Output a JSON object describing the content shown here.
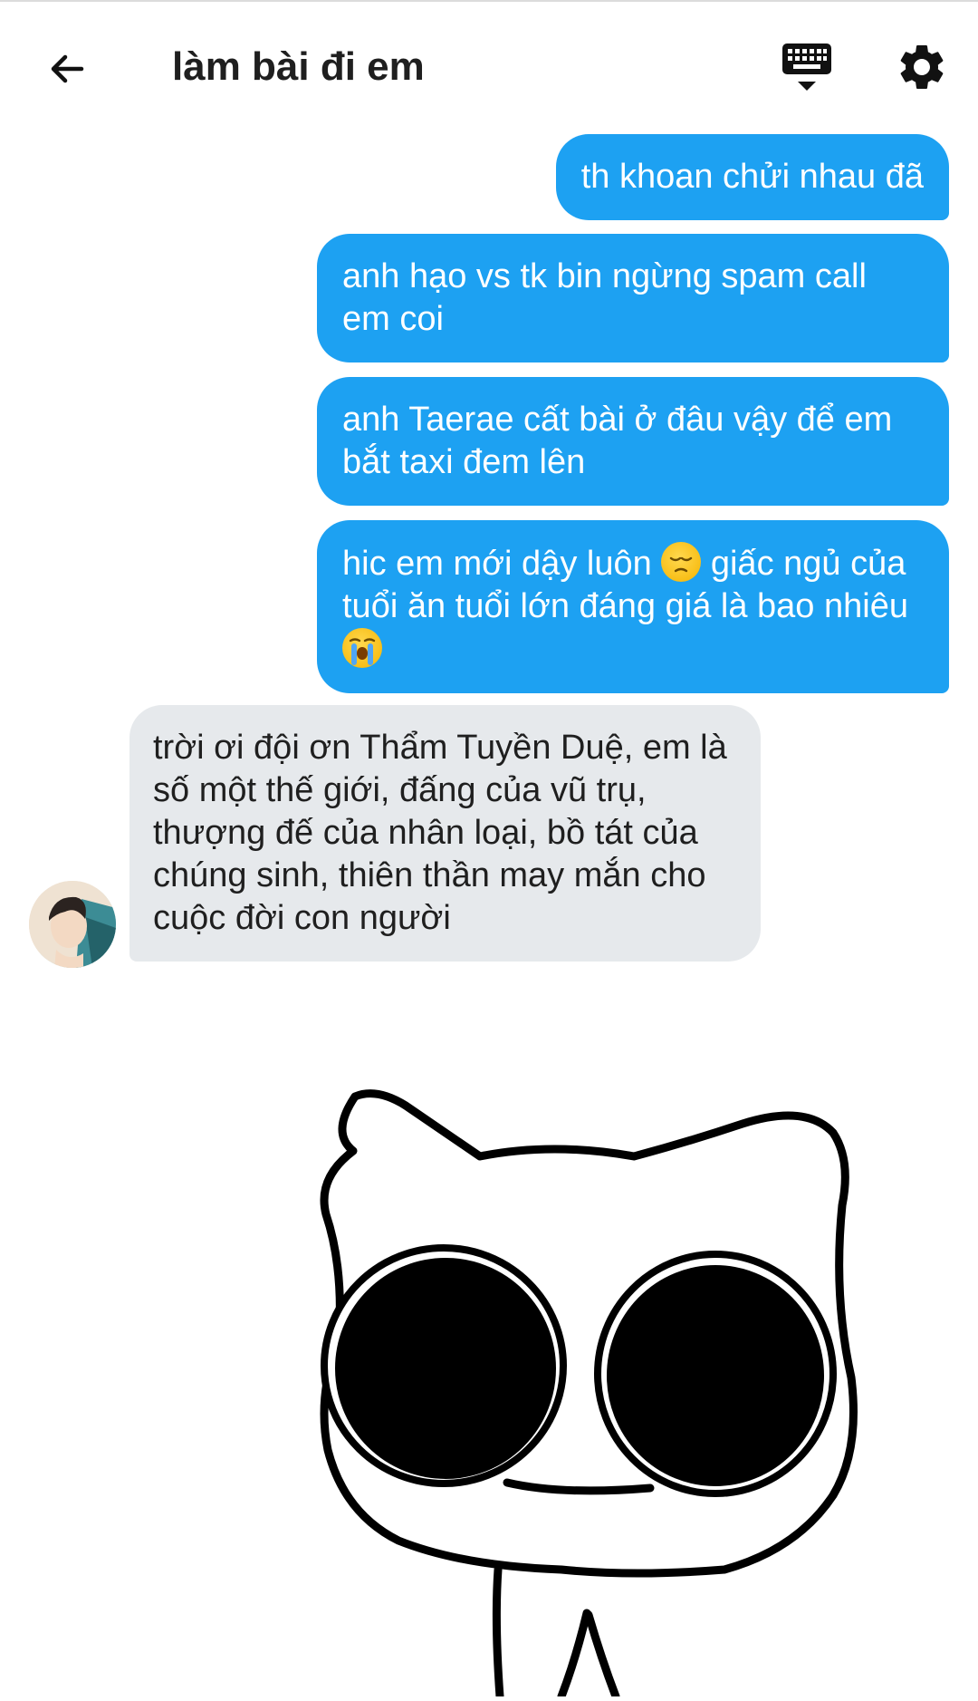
{
  "header": {
    "title": "làm bài đi em",
    "back_icon": "arrow-left-icon",
    "keyboard_icon": "keyboard-icon",
    "settings_icon": "gear-icon"
  },
  "messages": [
    {
      "direction": "sent",
      "text": "th khoan chửi nhau đã"
    },
    {
      "direction": "sent",
      "text": "anh hạo vs tk bin ngừng spam call em coi"
    },
    {
      "direction": "sent",
      "text": "anh Taerae cất bài ở đâu vậy để em bắt taxi đem lên"
    },
    {
      "direction": "sent",
      "text_a": "hic em mới dậy luôn",
      "text_b": "giấc ngủ của tuổi ăn tuổi lớn đáng giá là bao nhiêu"
    },
    {
      "direction": "received",
      "text": "trời ơi đội ơn Thẩm Tuyền Duệ, em là số một thế giới, đấng của vũ trụ, thượng đế của nhân loại, bồ tát của chúng sinh, thiên thần may mắn cho cuộc đời con người"
    }
  ],
  "colors": {
    "sent_bubble": "#1da1f2",
    "received_bubble": "#e6e9ec",
    "header_text": "#1f1f1f"
  },
  "media": {
    "icon": "cartoon-cat-sticker"
  }
}
